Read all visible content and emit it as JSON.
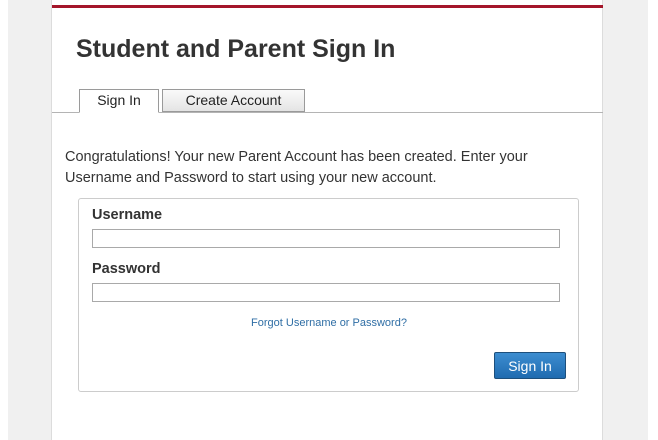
{
  "header": {
    "title": "Student and Parent Sign In"
  },
  "tabs": [
    {
      "label": "Sign In",
      "active": true
    },
    {
      "label": "Create Account",
      "active": false
    }
  ],
  "message": "Congratulations! Your new Parent Account has been created. Enter your Username and Password to start using your new account.",
  "form": {
    "username_label": "Username",
    "username_value": "",
    "password_label": "Password",
    "password_value": "",
    "forgot_link": "Forgot Username or Password?",
    "submit_label": "Sign In"
  },
  "colors": {
    "accent": "#a4162a",
    "button": "#2a75b8",
    "link": "#2f6ea5"
  }
}
